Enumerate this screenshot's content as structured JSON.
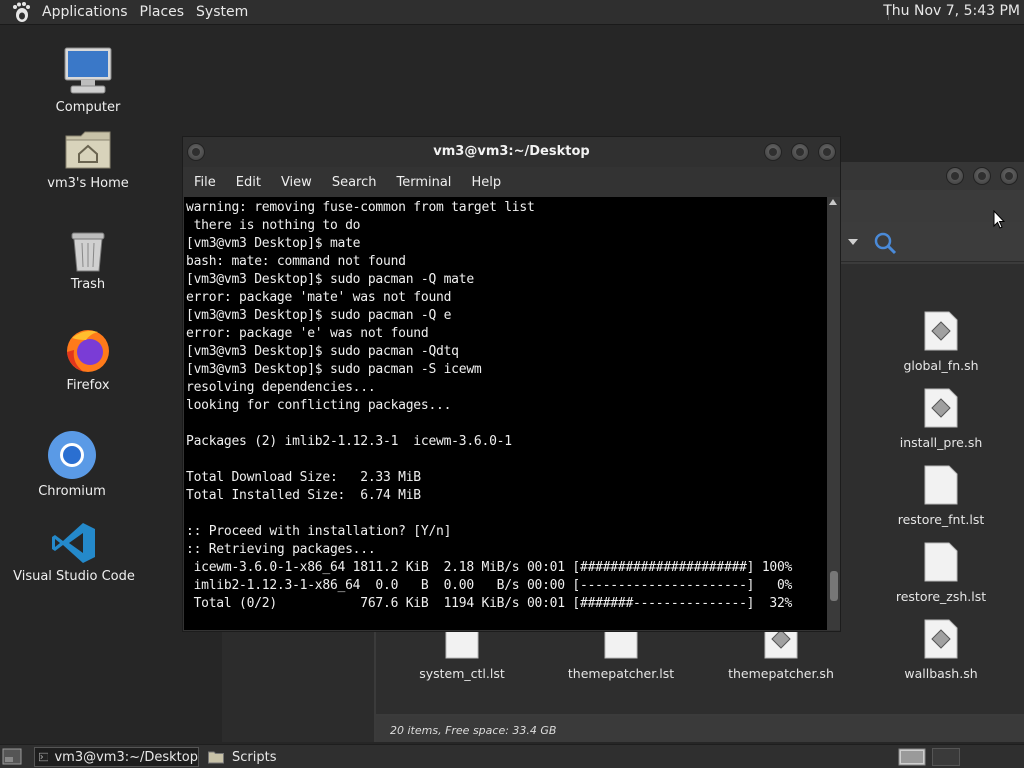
{
  "top_panel": {
    "menus": [
      "Applications",
      "Places",
      "System"
    ],
    "clock": "Thu Nov 7,  5:43 PM"
  },
  "desktop_icons": [
    {
      "label": "Computer"
    },
    {
      "label": "vm3's Home"
    },
    {
      "label": "Trash"
    },
    {
      "label": "Firefox"
    },
    {
      "label": "Chromium"
    },
    {
      "label": "Visual Studio Code"
    }
  ],
  "file_manager": {
    "files": [
      {
        "name": "global_fn.sh"
      },
      {
        "name": "install_pre.sh"
      },
      {
        "name": "restore_fnt.lst"
      },
      {
        "name": "restore_zsh.lst"
      },
      {
        "name": "system_ctl.lst"
      },
      {
        "name": "themepatcher.lst"
      },
      {
        "name": "themepatcher.sh"
      },
      {
        "name": "wallbash.sh"
      }
    ],
    "status": "20 items, Free space: 33.4 GB"
  },
  "terminal": {
    "title": "vm3@vm3:~/Desktop",
    "menu": [
      "File",
      "Edit",
      "View",
      "Search",
      "Terminal",
      "Help"
    ],
    "lines": [
      "warning: removing fuse-common from target list",
      " there is nothing to do",
      "[vm3@vm3 Desktop]$ mate",
      "bash: mate: command not found",
      "[vm3@vm3 Desktop]$ sudo pacman -Q mate",
      "error: package 'mate' was not found",
      "[vm3@vm3 Desktop]$ sudo pacman -Q e",
      "error: package 'e' was not found",
      "[vm3@vm3 Desktop]$ sudo pacman -Qdtq",
      "[vm3@vm3 Desktop]$ sudo pacman -S icewm",
      "resolving dependencies...",
      "looking for conflicting packages...",
      "",
      "Packages (2) imlib2-1.12.3-1  icewm-3.6.0-1",
      "",
      "Total Download Size:   2.33 MiB",
      "Total Installed Size:  6.74 MiB",
      "",
      ":: Proceed with installation? [Y/n]",
      ":: Retrieving packages...",
      " icewm-3.6.0-1-x86_64 1811.2 KiB  2.18 MiB/s 00:01 [######################] 100%",
      " imlib2-1.12.3-1-x86_64  0.0   B  0.00   B/s 00:00 [----------------------]   0%",
      " Total (0/2)           767.6 KiB  1194 KiB/s 00:01 [#######---------------]  32%"
    ]
  },
  "bottom_panel": {
    "tasks": [
      "vm3@vm3:~/Desktop",
      "Scripts"
    ]
  },
  "colors": {
    "panel": "#2f2f2f",
    "desktop": "#262626",
    "terminal_bg": "#000000"
  }
}
